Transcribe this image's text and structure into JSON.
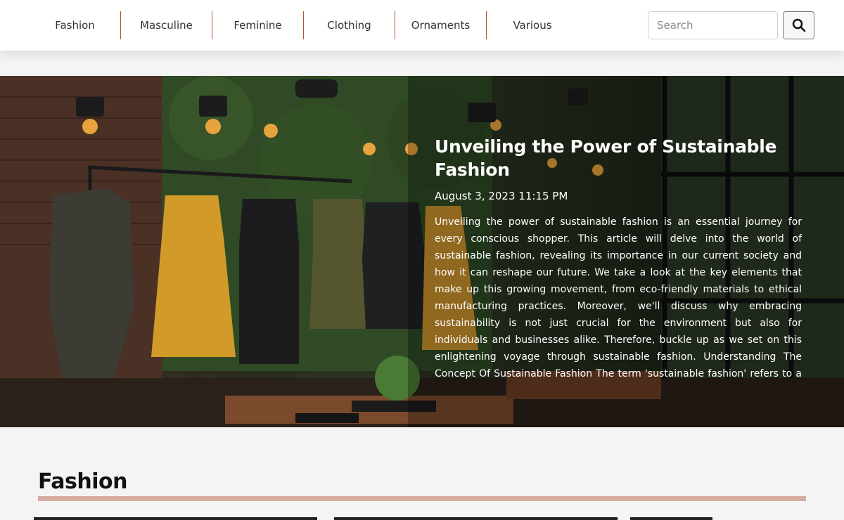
{
  "nav": {
    "items": [
      {
        "label": "Fashion"
      },
      {
        "label": "Masculine"
      },
      {
        "label": "Feminine"
      },
      {
        "label": "Clothing"
      },
      {
        "label": "Ornaments"
      },
      {
        "label": "Various"
      }
    ],
    "accent_color": "#b5532e"
  },
  "search": {
    "placeholder": "Search",
    "value": "",
    "icon": "search-icon"
  },
  "hero": {
    "title": "Unveiling the Power of Sustainable Fashion",
    "date": "August 3, 2023 11:15 PM",
    "excerpt": "Unveiling the power of sustainable fashion is an essential journey for every conscious shopper. This article will delve into the world of sustainable fashion, revealing its importance in our current society and how it can reshape our future. We take a look at the key elements that make up this growing movement, from eco-friendly materials to ethical manufacturing practices. Moreover, we'll discuss why embracing sustainability is not just crucial for the environment but also for individuals and businesses alike. Therefore, buckle up as we set on this enlightening voyage through sustainable fashion. Understanding The Concept Of Sustainable Fashion The term 'sustainable fashion' refers to a growing movement in the industry that seeks ..."
  },
  "section": {
    "title": "Fashion",
    "rule_color": "#d6ae9f"
  }
}
